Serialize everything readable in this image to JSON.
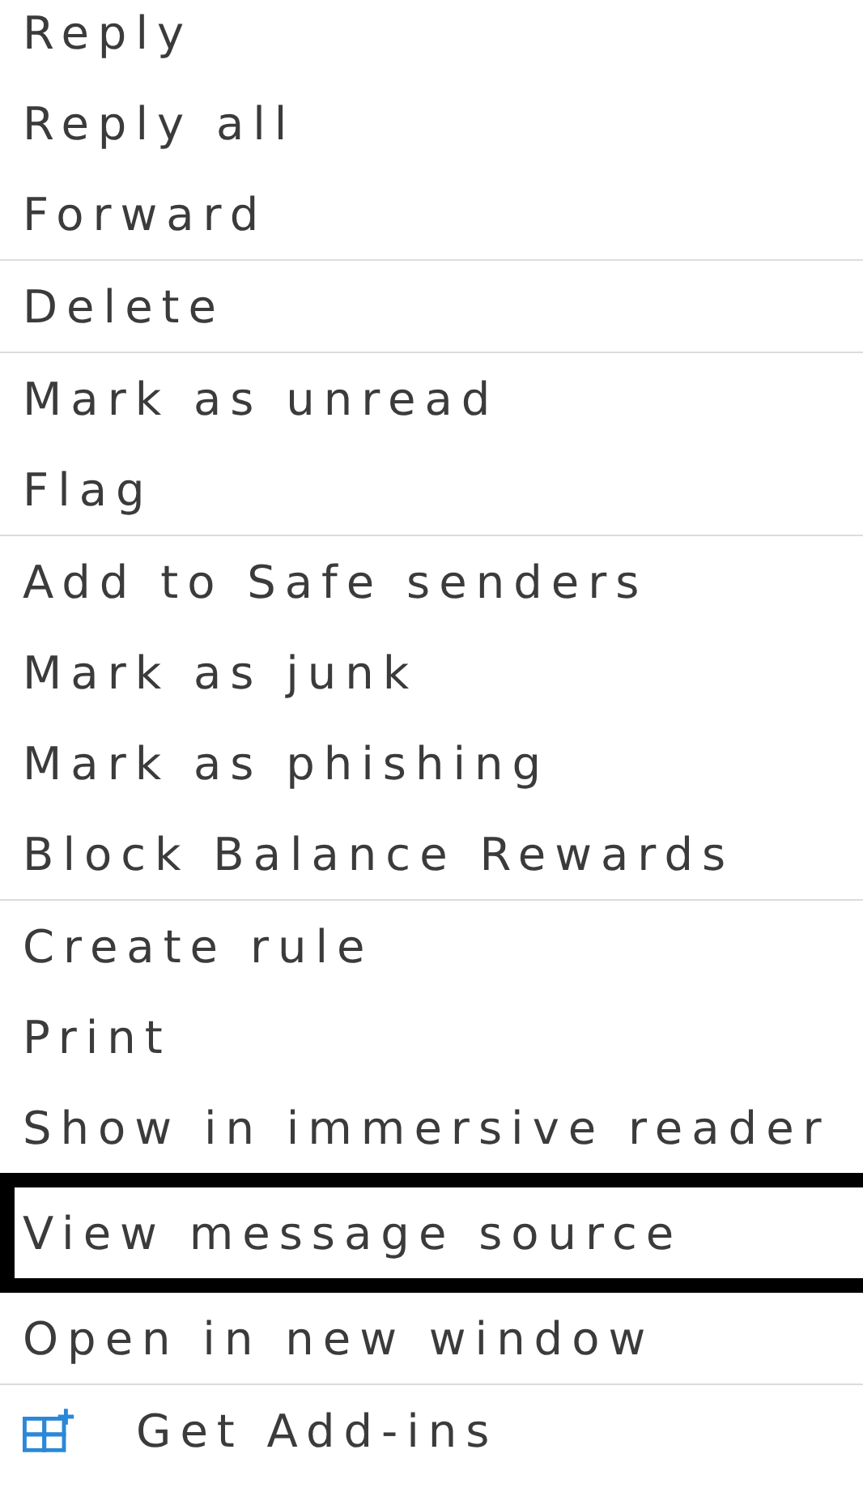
{
  "menu": {
    "sections": [
      {
        "items": [
          {
            "label": "Reply",
            "highlighted": false,
            "kind": "text"
          },
          {
            "label": "Reply all",
            "highlighted": false,
            "kind": "text"
          },
          {
            "label": "Forward",
            "highlighted": false,
            "kind": "text"
          }
        ]
      },
      {
        "items": [
          {
            "label": "Delete",
            "highlighted": false,
            "kind": "text"
          }
        ]
      },
      {
        "items": [
          {
            "label": "Mark as unread",
            "highlighted": false,
            "kind": "text"
          },
          {
            "label": "Flag",
            "highlighted": false,
            "kind": "text"
          }
        ]
      },
      {
        "items": [
          {
            "label": "Add to Safe senders",
            "highlighted": false,
            "kind": "text"
          },
          {
            "label": "Mark as junk",
            "highlighted": false,
            "kind": "text"
          },
          {
            "label": "Mark as phishing",
            "highlighted": false,
            "kind": "text"
          },
          {
            "label": "Block Balance Rewards",
            "highlighted": false,
            "kind": "text"
          }
        ]
      },
      {
        "items": [
          {
            "label": "Create rule",
            "highlighted": false,
            "kind": "text"
          },
          {
            "label": "Print",
            "highlighted": false,
            "kind": "text"
          },
          {
            "label": "Show in immersive reader",
            "highlighted": false,
            "kind": "text"
          },
          {
            "label": "View message source",
            "highlighted": true,
            "kind": "text"
          },
          {
            "label": "Open in new window",
            "highlighted": false,
            "kind": "text"
          }
        ]
      },
      {
        "items": [
          {
            "label": "Get Add-ins",
            "highlighted": false,
            "kind": "icon"
          }
        ]
      }
    ]
  }
}
